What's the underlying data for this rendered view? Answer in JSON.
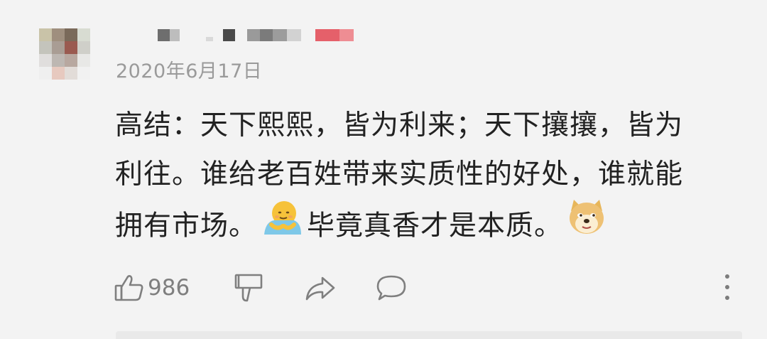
{
  "comment": {
    "username": "",
    "date": "2020年6月17日",
    "lines": {
      "l1": "高结：天下熙熙，皆为利来；天下攘攘，皆为",
      "l2": "利往。谁给老百姓带来实质性的好处，谁就能",
      "l3a": "拥有市场。",
      "l3b": "毕竟真香才是本质。"
    },
    "emojis": [
      "hug-emoji",
      "doge-emoji"
    ],
    "actions": {
      "like_count": "986",
      "like_icon": "thumbs-up-icon",
      "dislike_icon": "thumbs-down-icon",
      "share_icon": "share-arrow-icon",
      "reply_icon": "speech-bubble-icon",
      "more_icon": "more-vertical-icon"
    }
  },
  "colors": {
    "background": "#f3f3f3",
    "text": "#222222",
    "meta": "#9a9a9a",
    "icon": "#7f7f7f",
    "username_highlight": "#e5606a"
  }
}
